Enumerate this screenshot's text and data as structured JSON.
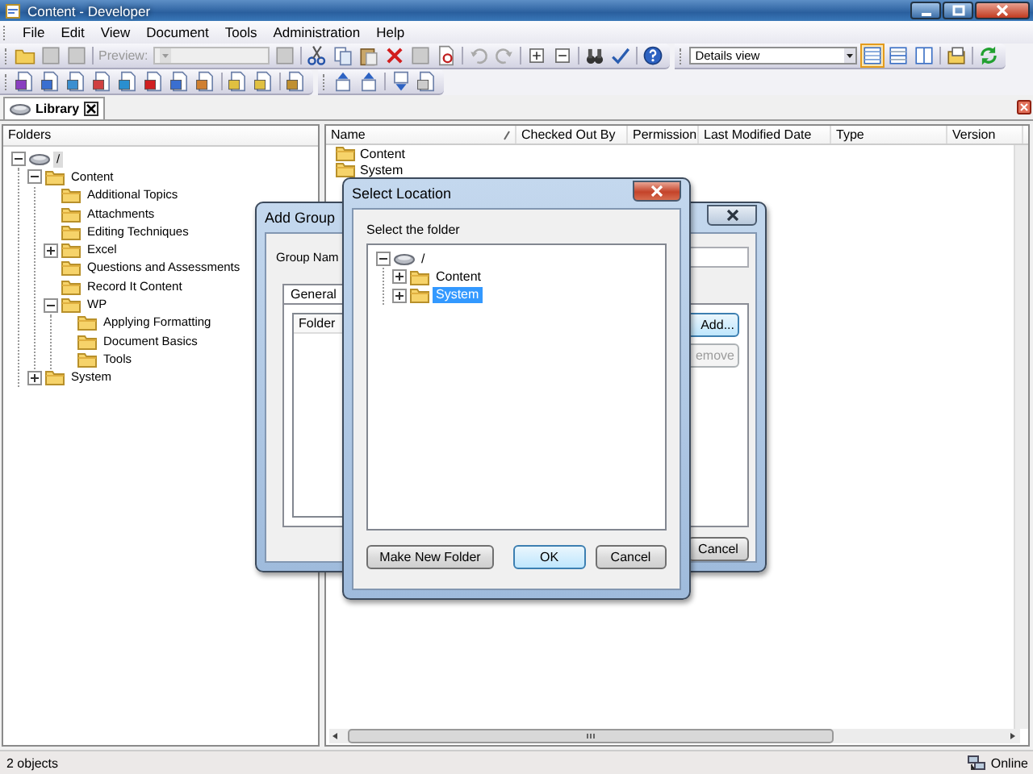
{
  "window": {
    "title": "Content - Developer"
  },
  "menu": [
    "File",
    "Edit",
    "View",
    "Document",
    "Tools",
    "Administration",
    "Help"
  ],
  "toolbar": {
    "preview": {
      "label": "Preview:",
      "disabled": true
    },
    "view_mode": "Details view",
    "view_buttons": [
      {
        "selected": true
      },
      {
        "selected": false
      },
      {
        "selected": false
      }
    ]
  },
  "tabs": [
    {
      "label": "Library",
      "selected": true
    }
  ],
  "folders": {
    "header": "Folders",
    "tree": [
      {
        "label": "/",
        "kind": "drive",
        "expanded": true,
        "selected": true,
        "children": [
          {
            "label": "Content",
            "expanded": true,
            "selected": false,
            "children": [
              {
                "label": "Additional Topics",
                "selected": false
              },
              {
                "label": "Attachments",
                "selected": false
              },
              {
                "label": "Editing Techniques",
                "selected": false
              },
              {
                "label": "Excel",
                "expanded": false,
                "selected": false
              },
              {
                "label": "Questions and Assessments",
                "selected": false
              },
              {
                "label": "Record It Content",
                "selected": false
              },
              {
                "label": "WP",
                "expanded": true,
                "selected": false,
                "children": [
                  {
                    "label": "Applying Formatting",
                    "selected": false
                  },
                  {
                    "label": "Document Basics",
                    "selected": false
                  },
                  {
                    "label": "Tools",
                    "selected": false
                  }
                ]
              }
            ]
          },
          {
            "label": "System",
            "expanded": false,
            "selected": false
          }
        ]
      }
    ]
  },
  "file_list": {
    "columns": [
      "Name",
      "Checked Out By",
      "Permission",
      "Last Modified Date",
      "Type",
      "Version"
    ],
    "rows": [
      {
        "name": "Content"
      },
      {
        "name": "System"
      }
    ]
  },
  "add_group_dialog": {
    "title": "Add Group",
    "group_name_label": "Group Nam",
    "tabs": [
      {
        "label": "General",
        "selected": true
      }
    ],
    "list_header": "Folder",
    "buttons": [
      {
        "label": "Add...",
        "disabled": false
      },
      {
        "label": "emove",
        "disabled": true
      }
    ],
    "cancel": "Cancel"
  },
  "select_location_dialog": {
    "title": "Select Location",
    "prompt": "Select the folder",
    "tree": [
      {
        "label": "/",
        "kind": "drive",
        "expanded": true,
        "selected": false,
        "children": [
          {
            "label": "Content",
            "expanded": false,
            "selected": false
          },
          {
            "label": "System",
            "expanded": false,
            "selected": true
          }
        ]
      }
    ],
    "buttons": [
      {
        "label": "Make New Folder",
        "default": false
      },
      {
        "label": "OK",
        "default": true
      },
      {
        "label": "Cancel",
        "default": false
      }
    ]
  },
  "status_bar": {
    "count": "2 objects",
    "connection": "Online"
  }
}
